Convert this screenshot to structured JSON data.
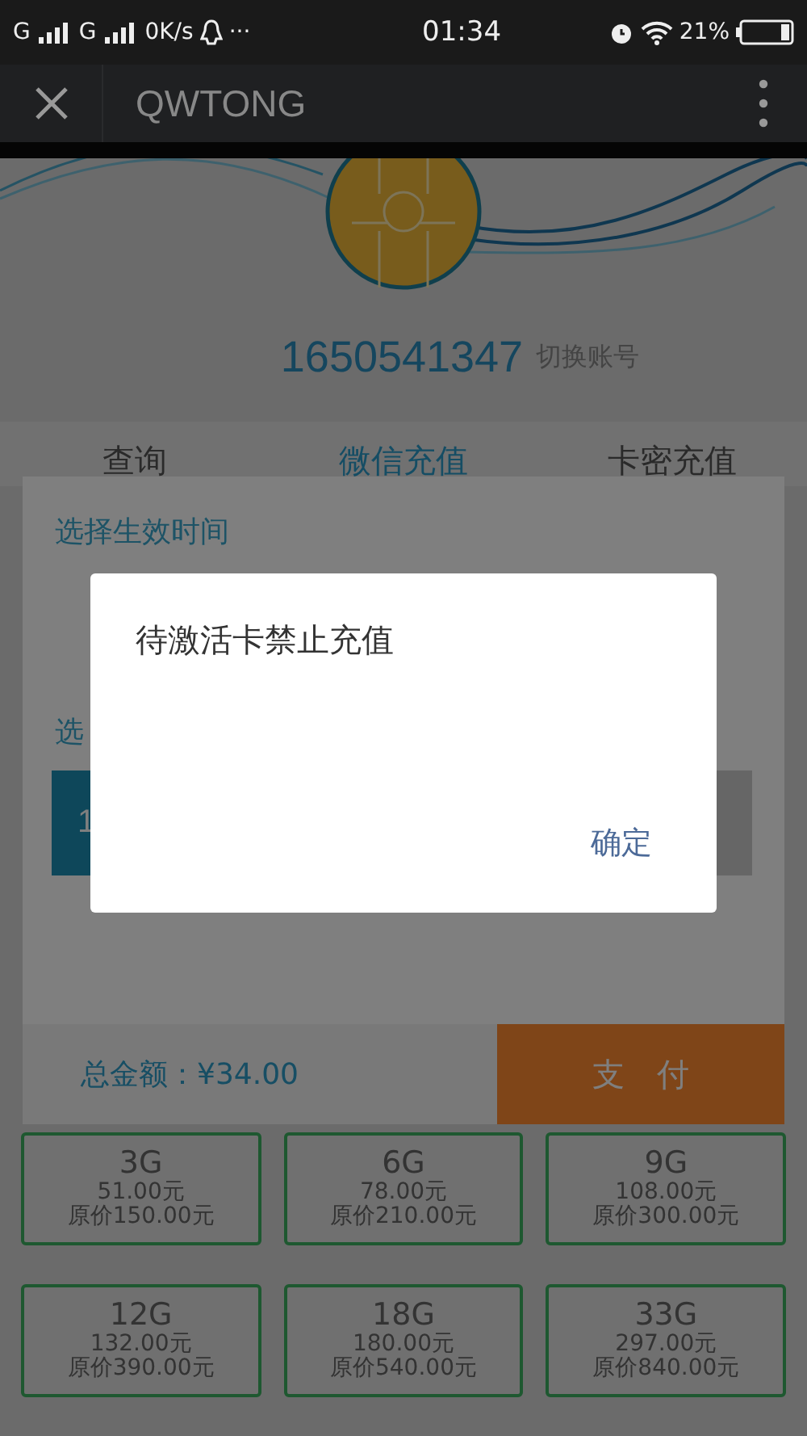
{
  "status_bar": {
    "signal_1": "G",
    "signal_2": "G",
    "speed": "0K/s",
    "dots": "···",
    "time": "01:34",
    "battery": "21%"
  },
  "app_bar": {
    "title": "QWTONG"
  },
  "account": {
    "number": "1650541347",
    "switch_link": "切换账号"
  },
  "tabs": [
    {
      "label": "查询",
      "selected": false
    },
    {
      "label": "微信充值",
      "selected": true
    },
    {
      "label": "卡密充值",
      "selected": false
    }
  ],
  "sheet": {
    "time_title": "选择生效时间",
    "second_title": "选",
    "options": [
      {
        "label": "1",
        "selected": true
      },
      {
        "selected": false
      }
    ],
    "total": "总金额：¥34.00",
    "pay_button": "支　付"
  },
  "packages": [
    {
      "size": "3G",
      "price": "51.00元",
      "original": "原价150.00元"
    },
    {
      "size": "6G",
      "price": "78.00元",
      "original": "原价210.00元"
    },
    {
      "size": "9G",
      "price": "108.00元",
      "original": "原价300.00元"
    },
    {
      "size": "12G",
      "price": "132.00元",
      "original": "原价390.00元"
    },
    {
      "size": "18G",
      "price": "180.00元",
      "original": "原价540.00元"
    },
    {
      "size": "33G",
      "price": "297.00元",
      "original": "原价840.00元"
    }
  ],
  "dialog": {
    "message": "待激活卡禁止充值",
    "confirm": "确定"
  }
}
